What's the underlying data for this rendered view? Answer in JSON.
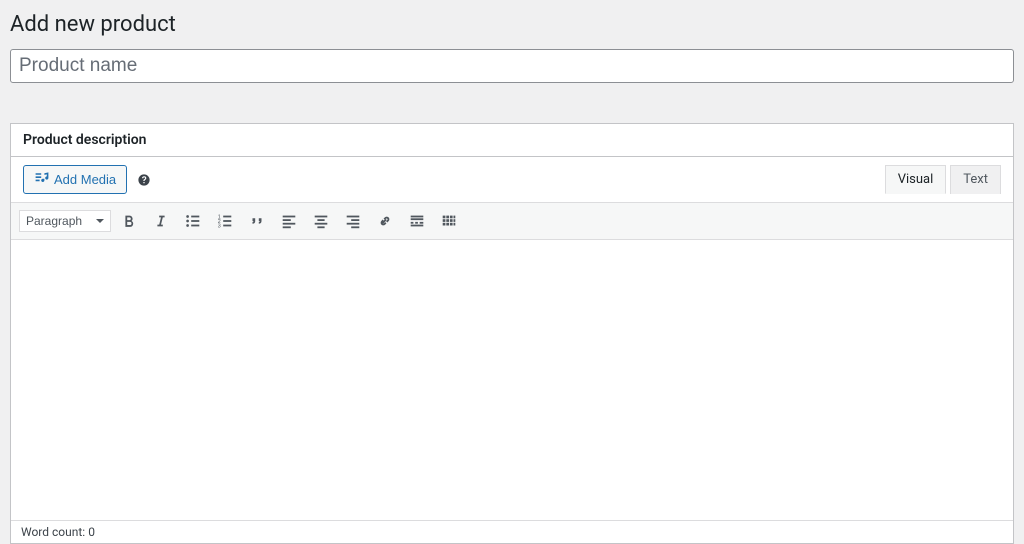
{
  "page": {
    "title": "Add new product"
  },
  "product_name": {
    "value": "",
    "placeholder": "Product name"
  },
  "description_box": {
    "title": "Product description",
    "add_media_label": "Add Media",
    "tabs": {
      "visual": "Visual",
      "text": "Text"
    },
    "toolbar": {
      "format_selected": "Paragraph"
    },
    "content": "",
    "footer": {
      "word_count_label": "Word count:",
      "word_count_value": "0"
    }
  }
}
